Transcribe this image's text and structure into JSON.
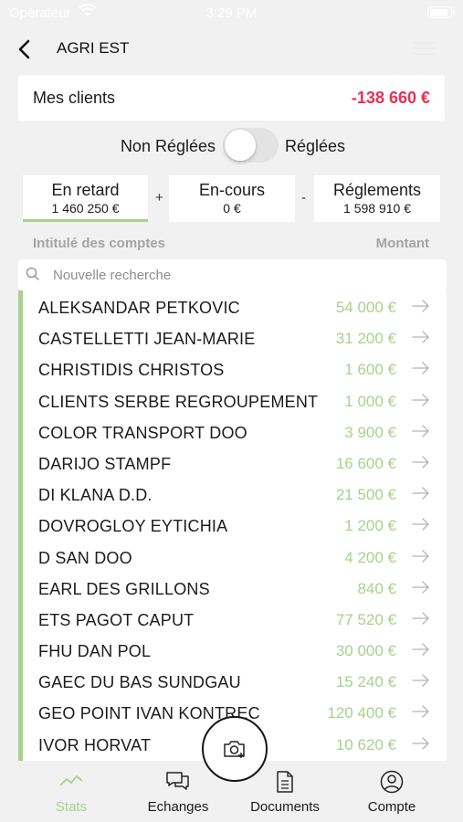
{
  "status": {
    "carrier": "Opérateur",
    "time": "3:29 PM"
  },
  "nav": {
    "title": "AGRI EST"
  },
  "summary": {
    "label": "Mes clients",
    "amount": "-138 660 €"
  },
  "filter": {
    "left_label": "Non Réglées",
    "right_label": "Réglées"
  },
  "tiles": [
    {
      "title": "En retard",
      "value": "1 460 250 €"
    },
    {
      "title": "En-cours",
      "value": "0 €"
    },
    {
      "title": "Réglements",
      "value": "1 598 910 €"
    }
  ],
  "operators": {
    "plus": "+",
    "minus": "-"
  },
  "columns": {
    "account": "Intitulé des comptes",
    "amount": "Montant"
  },
  "search": {
    "placeholder": "Nouvelle recherche"
  },
  "accounts": [
    {
      "name": "ALEKSANDAR PETKOVIC",
      "amount": "54 000 €"
    },
    {
      "name": "CASTELLETTI JEAN-MARIE",
      "amount": "31 200 €"
    },
    {
      "name": "CHRISTIDIS CHRISTOS",
      "amount": "1 600 €"
    },
    {
      "name": "CLIENTS SERBE REGROUPEMENT",
      "amount": "1 000 €"
    },
    {
      "name": "COLOR TRANSPORT DOO",
      "amount": "3 900 €"
    },
    {
      "name": "DARIJO STAMPF",
      "amount": "16 600 €"
    },
    {
      "name": "DI KLANA D.D.",
      "amount": "21 500 €"
    },
    {
      "name": "DOVROGLOY EYTICHIA",
      "amount": "1 200 €"
    },
    {
      "name": "D SAN DOO",
      "amount": "4 200 €"
    },
    {
      "name": "EARL DES GRILLONS",
      "amount": "840 €"
    },
    {
      "name": "ETS PAGOT CAPUT",
      "amount": "77 520 €"
    },
    {
      "name": "FHU DAN POL",
      "amount": "30 000 €"
    },
    {
      "name": "GAEC DU BAS SUNDGAU",
      "amount": "15 240 €"
    },
    {
      "name": "GEO POINT IVAN KONTREC",
      "amount": "120 400 €"
    },
    {
      "name": "IVOR HORVAT",
      "amount": "10 620 €"
    }
  ],
  "tabs": [
    {
      "label": "Stats",
      "icon": "chart-line-icon"
    },
    {
      "label": "Echanges",
      "icon": "chat-bubbles-icon"
    },
    {
      "label": "Documents",
      "icon": "document-icon"
    },
    {
      "label": "Compte",
      "icon": "account-icon"
    }
  ],
  "colors": {
    "accent": "#a8d18e",
    "negative": "#ec2f55",
    "background": "#f1f1f1"
  }
}
